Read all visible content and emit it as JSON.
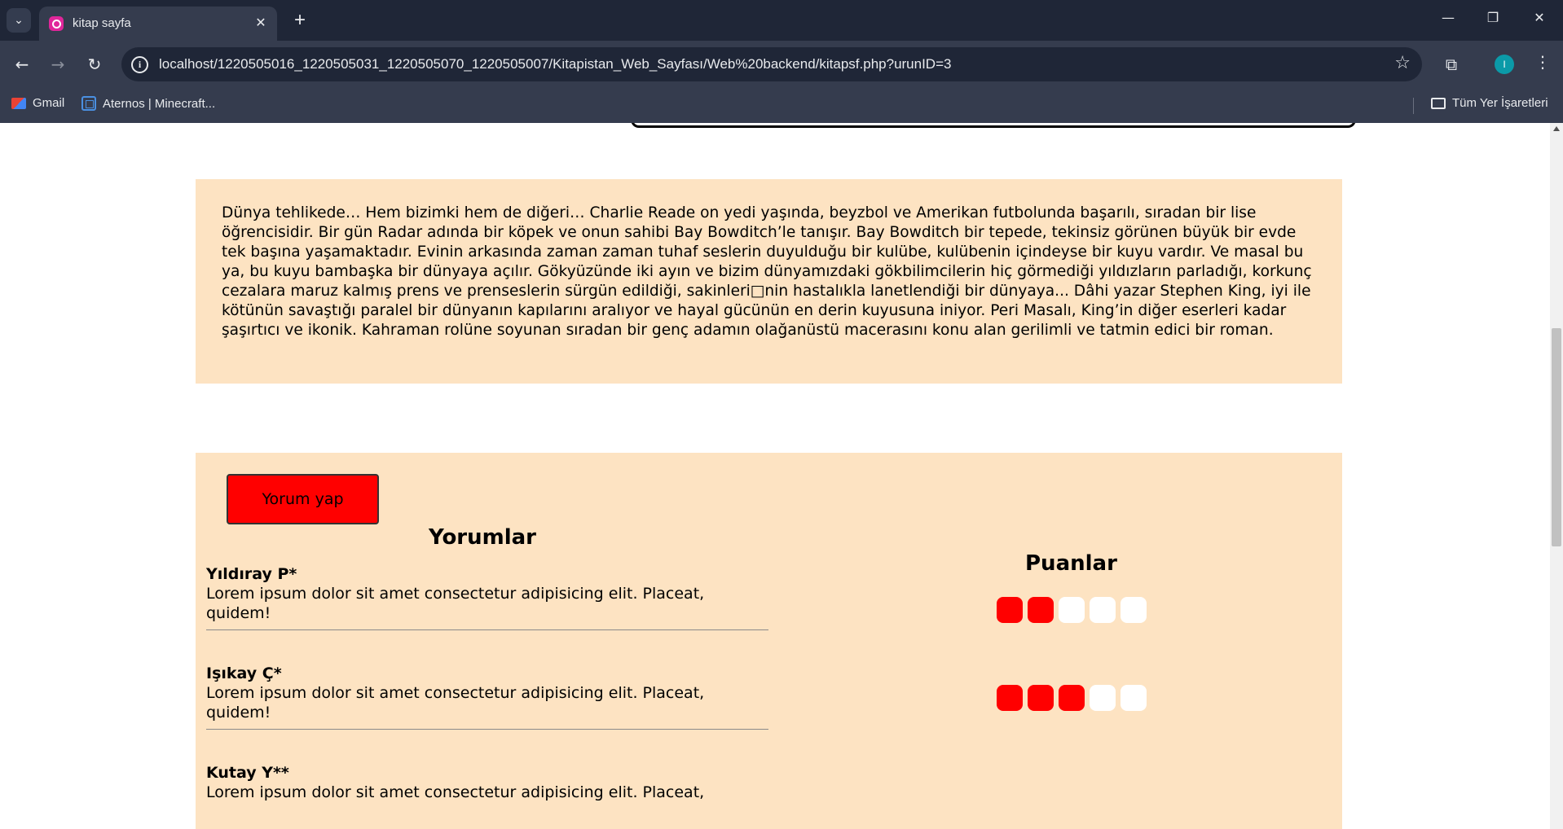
{
  "browser": {
    "tab_title": "kitap sayfa",
    "url": "localhost/1220505016_1220505031_1220505070_1220505007/Kitapistan_Web_Sayfası/Web%20backend/kitapsf.php?urunID=3",
    "profile_initial": "I",
    "bookmarks": [
      {
        "label": "Gmail",
        "icon": "gmail-icon"
      },
      {
        "label": "Aternos | Minecraft...",
        "icon": "aternos-icon"
      }
    ],
    "all_bookmarks_label": "Tüm Yer İşaretleri"
  },
  "description": {
    "text": "Dünya tehlikede… Hem bizimki hem de diğeri… Charlie Reade on yedi yaşında, beyzbol ve Amerikan futbolunda başarılı, sıradan bir lise öğrencisidir. Bir gün Radar adında bir köpek ve onun sahibi Bay Bowditch’le tanışır. Bay Bowditch bir tepede, tekinsiz görünen büyük bir evde tek başına yaşamaktadır. Evinin arkasında zaman zaman tuhaf seslerin duyulduğu bir kulübe, kulübenin içindeyse bir kuyu vardır. Ve masal bu ya, bu kuyu bambaşka bir dünyaya açılır. Gökyüzünde iki ayın ve bizim dünyamızdaki gökbilimcilerin hiç görmediği yıldızların parladığı, korkunç cezalara maruz kalmış prens ve prenseslerin sürgün edildiği, sakinleri□nin hastalıkla lanetlendiği bir dünyaya... Dâhi yazar Stephen King, iyi ile kötünün savaştığı paralel bir dünyanın kapılarını aralıyor ve hayal gücünün en derin kuyusuna iniyor. Peri Masalı, King’in diğer eserleri kadar şaşırtıcı ve ikonik. Kahraman rolüne soyunan sıradan bir genç adamın olağanüstü macerasını konu alan gerilimli ve tatmin edici bir roman."
  },
  "reviews": {
    "button_label": "Yorum yap",
    "comments_title": "Yorumlar",
    "ratings_title": "Puanlar",
    "items": [
      {
        "name": "Yıldıray P*",
        "text": "Lorem ipsum dolor sit amet consectetur adipisicing elit. Placeat, quidem!",
        "rating": 2
      },
      {
        "name": "Işıkay Ç*",
        "text": "Lorem ipsum dolor sit amet consectetur adipisicing elit. Placeat, quidem!",
        "rating": 3
      },
      {
        "name": "Kutay Y**",
        "text": "Lorem ipsum dolor sit amet consectetur adipisicing elit. Placeat,",
        "rating": null
      }
    ],
    "rating_max": 5
  },
  "colors": {
    "panel": "#fde3c2",
    "accent": "#ff0000"
  }
}
